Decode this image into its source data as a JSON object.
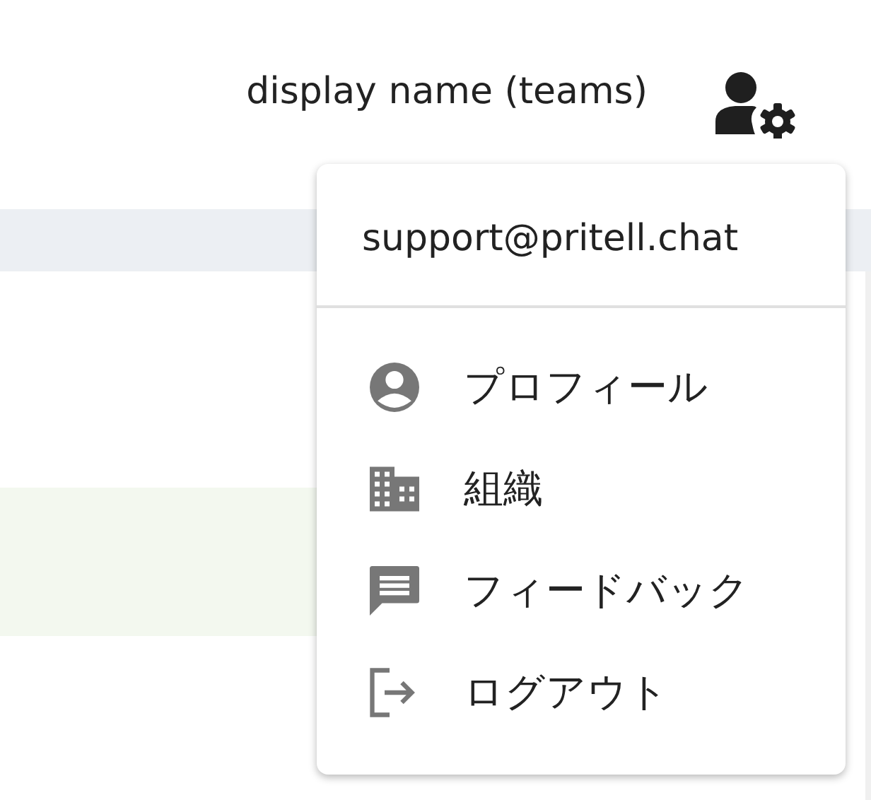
{
  "header": {
    "display_name": "display name (teams)"
  },
  "user_menu": {
    "email": "support@pritell.chat",
    "items": [
      {
        "label": "プロフィール",
        "kind": "profile"
      },
      {
        "label": "組織",
        "kind": "organization"
      },
      {
        "label": "フィードバック",
        "kind": "feedback"
      },
      {
        "label": "ログアウト",
        "kind": "logout"
      }
    ]
  }
}
